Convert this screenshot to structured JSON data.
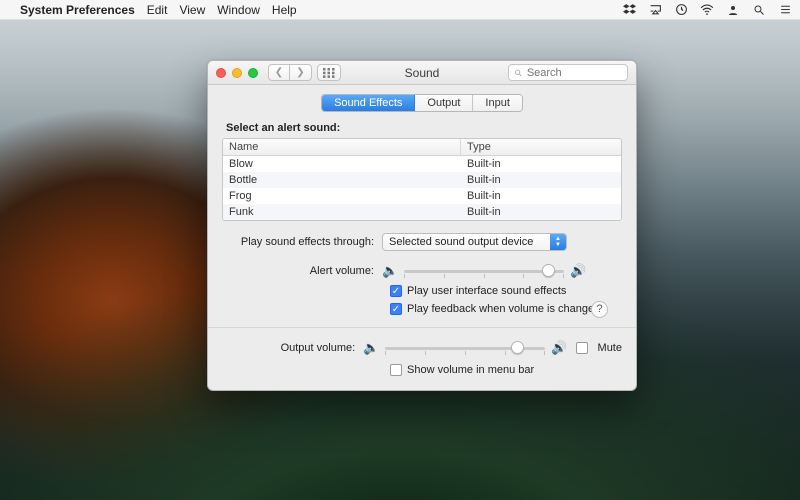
{
  "menubar": {
    "app": "System Preferences",
    "items": [
      "Edit",
      "View",
      "Window",
      "Help"
    ]
  },
  "window": {
    "title": "Sound",
    "search_placeholder": "Search"
  },
  "tabs": [
    {
      "label": "Sound Effects",
      "active": true
    },
    {
      "label": "Output",
      "active": false
    },
    {
      "label": "Input",
      "active": false
    }
  ],
  "alerts": {
    "heading": "Select an alert sound:",
    "columns": {
      "name": "Name",
      "type": "Type"
    },
    "rows": [
      {
        "name": "Blow",
        "type": "Built-in"
      },
      {
        "name": "Bottle",
        "type": "Built-in"
      },
      {
        "name": "Frog",
        "type": "Built-in"
      },
      {
        "name": "Funk",
        "type": "Built-in"
      }
    ]
  },
  "play_through": {
    "label": "Play sound effects through:",
    "value": "Selected sound output device"
  },
  "alert_volume": {
    "label": "Alert volume:",
    "value": 0.9
  },
  "checkboxes": {
    "ui_sounds": {
      "label": "Play user interface sound effects",
      "checked": true
    },
    "vol_feedback": {
      "label": "Play feedback when volume is changed",
      "checked": true
    }
  },
  "output_volume": {
    "label": "Output volume:",
    "value": 0.82
  },
  "mute": {
    "label": "Mute",
    "checked": false
  },
  "show_in_menubar": {
    "label": "Show volume in menu bar",
    "checked": false
  }
}
